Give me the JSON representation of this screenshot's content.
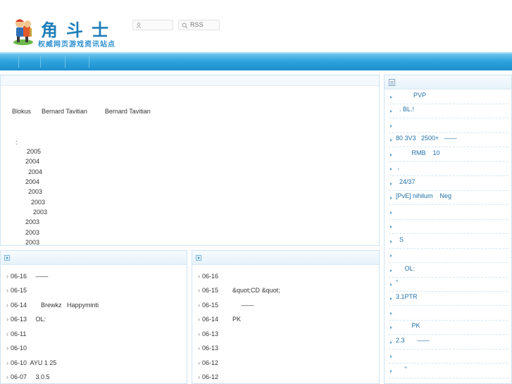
{
  "site": {
    "logo_title": "角斗士",
    "logo_subtitle": "权威网页游戏资讯站点",
    "rss_label": "RSS"
  },
  "nav": {
    "items": [
      "",
      "",
      "",
      ""
    ]
  },
  "article": {
    "intro": "Blokus      Bernard Tavitian          Bernard Tavitian",
    "colon": ":",
    "years": [
      "2005",
      "2004",
      "2004",
      "2004",
      "2003",
      "2003",
      "2003",
      "2003",
      "2003",
      "2003"
    ]
  },
  "left_list": [
    {
      "date": "06-16",
      "text": "     ——"
    },
    {
      "date": "06-15",
      "text": ""
    },
    {
      "date": "06-14",
      "text": "        Brewkz   Happyminti"
    },
    {
      "date": "06-13",
      "text": "     OL:"
    },
    {
      "date": "06-11",
      "text": ""
    },
    {
      "date": "06-10",
      "text": ""
    },
    {
      "date": "06-10",
      "text": "  AYU 1 25"
    },
    {
      "date": "06-07",
      "text": "     3.0.5"
    }
  ],
  "right_list": [
    {
      "date": "06-16",
      "text": ""
    },
    {
      "date": "06-15",
      "text": "        &quot;CD &quot;"
    },
    {
      "date": "06-15",
      "text": "             ——"
    },
    {
      "date": "06-14",
      "text": "        PK"
    },
    {
      "date": "06-13",
      "text": ""
    },
    {
      "date": "06-13",
      "text": ""
    },
    {
      "date": "06-12",
      "text": ""
    },
    {
      "date": "06-12",
      "text": ""
    }
  ],
  "sidebar": {
    "items": [
      "          PVP",
      "  . BL.!",
      "",
      "80 3V3   2500+   ——",
      "         RMB    10",
      " ,",
      "  24/37",
      "[PvE] nihilum    Neg",
      "",
      "",
      "  S",
      "",
      "     OL:",
      "\"",
      "3.1PTR",
      "",
      "         PK",
      "2.3       ——",
      "",
      "     \""
    ]
  }
}
